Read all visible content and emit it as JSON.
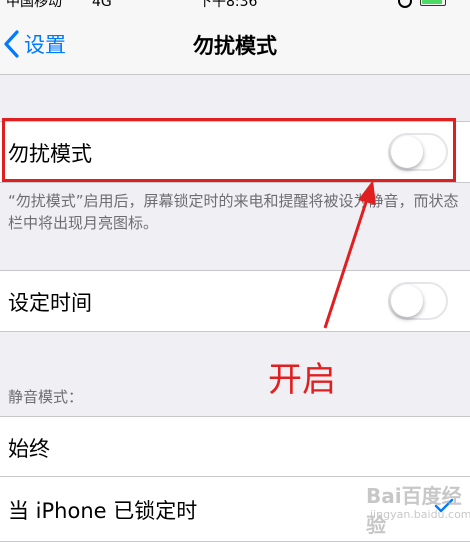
{
  "status_bar": {
    "carrier": "中国移动",
    "network": "4G",
    "time": "下午8:36"
  },
  "nav": {
    "back_label": "设置",
    "title": "勿扰模式"
  },
  "settings": {
    "dnd_label": "勿扰模式",
    "dnd_enabled": false,
    "footnote": "“勿扰模式”启用后，屏幕锁定时的来电和提醒将被设为静音，而状态栏中将出现月亮图标。",
    "scheduled_label": "设定时间",
    "scheduled_enabled": false,
    "silence_header": "静音模式：",
    "silence_options": [
      {
        "label": "始终",
        "selected": false
      },
      {
        "label": "当 iPhone 已锁定时",
        "selected": true
      }
    ]
  },
  "annotation": {
    "text": "开启",
    "color": "#e02020"
  },
  "watermark": {
    "brand": "Bai百度经验",
    "url": "jingyan.baidu.com"
  },
  "colors": {
    "accent": "#007aff",
    "background": "#efeff4",
    "separator": "#c8c7cc"
  }
}
